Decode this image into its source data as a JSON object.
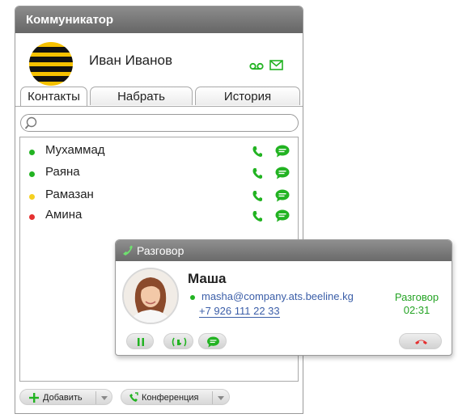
{
  "window": {
    "title": "Коммуникатор"
  },
  "profile": {
    "name": "Иван Иванов"
  },
  "tabs": [
    {
      "label": "Контакты",
      "active": true
    },
    {
      "label": "Набрать",
      "active": false
    },
    {
      "label": "История",
      "active": false
    }
  ],
  "search": {
    "placeholder": ""
  },
  "contacts": [
    {
      "name": "Мухаммад",
      "status_color": "#22b322"
    },
    {
      "name": "Раяна",
      "status_color": "#22b322"
    },
    {
      "name": "Рамазан",
      "status_color": "#f5d020"
    },
    {
      "name": "Амина",
      "status_color": "#e53030"
    }
  ],
  "buttons": {
    "add": "Добавить",
    "conference": "Конференция"
  },
  "call": {
    "title": "Разговор",
    "contact_name": "Маша",
    "email": "masha@company.ats.beeline.kg",
    "phone": "+7 926 111 22 33",
    "status_label": "Разговор",
    "duration": "02:31"
  },
  "colors": {
    "accent_green": "#22b322",
    "hangup_red": "#e53030",
    "link_blue": "#3b5ea8",
    "brand_yellow": "#f6c100"
  },
  "icons": [
    "voicemail-icon",
    "mail-icon",
    "search-icon",
    "call-icon",
    "chat-icon",
    "plus-icon",
    "conference-icon",
    "pause-icon",
    "transfer-icon",
    "hangup-icon"
  ]
}
